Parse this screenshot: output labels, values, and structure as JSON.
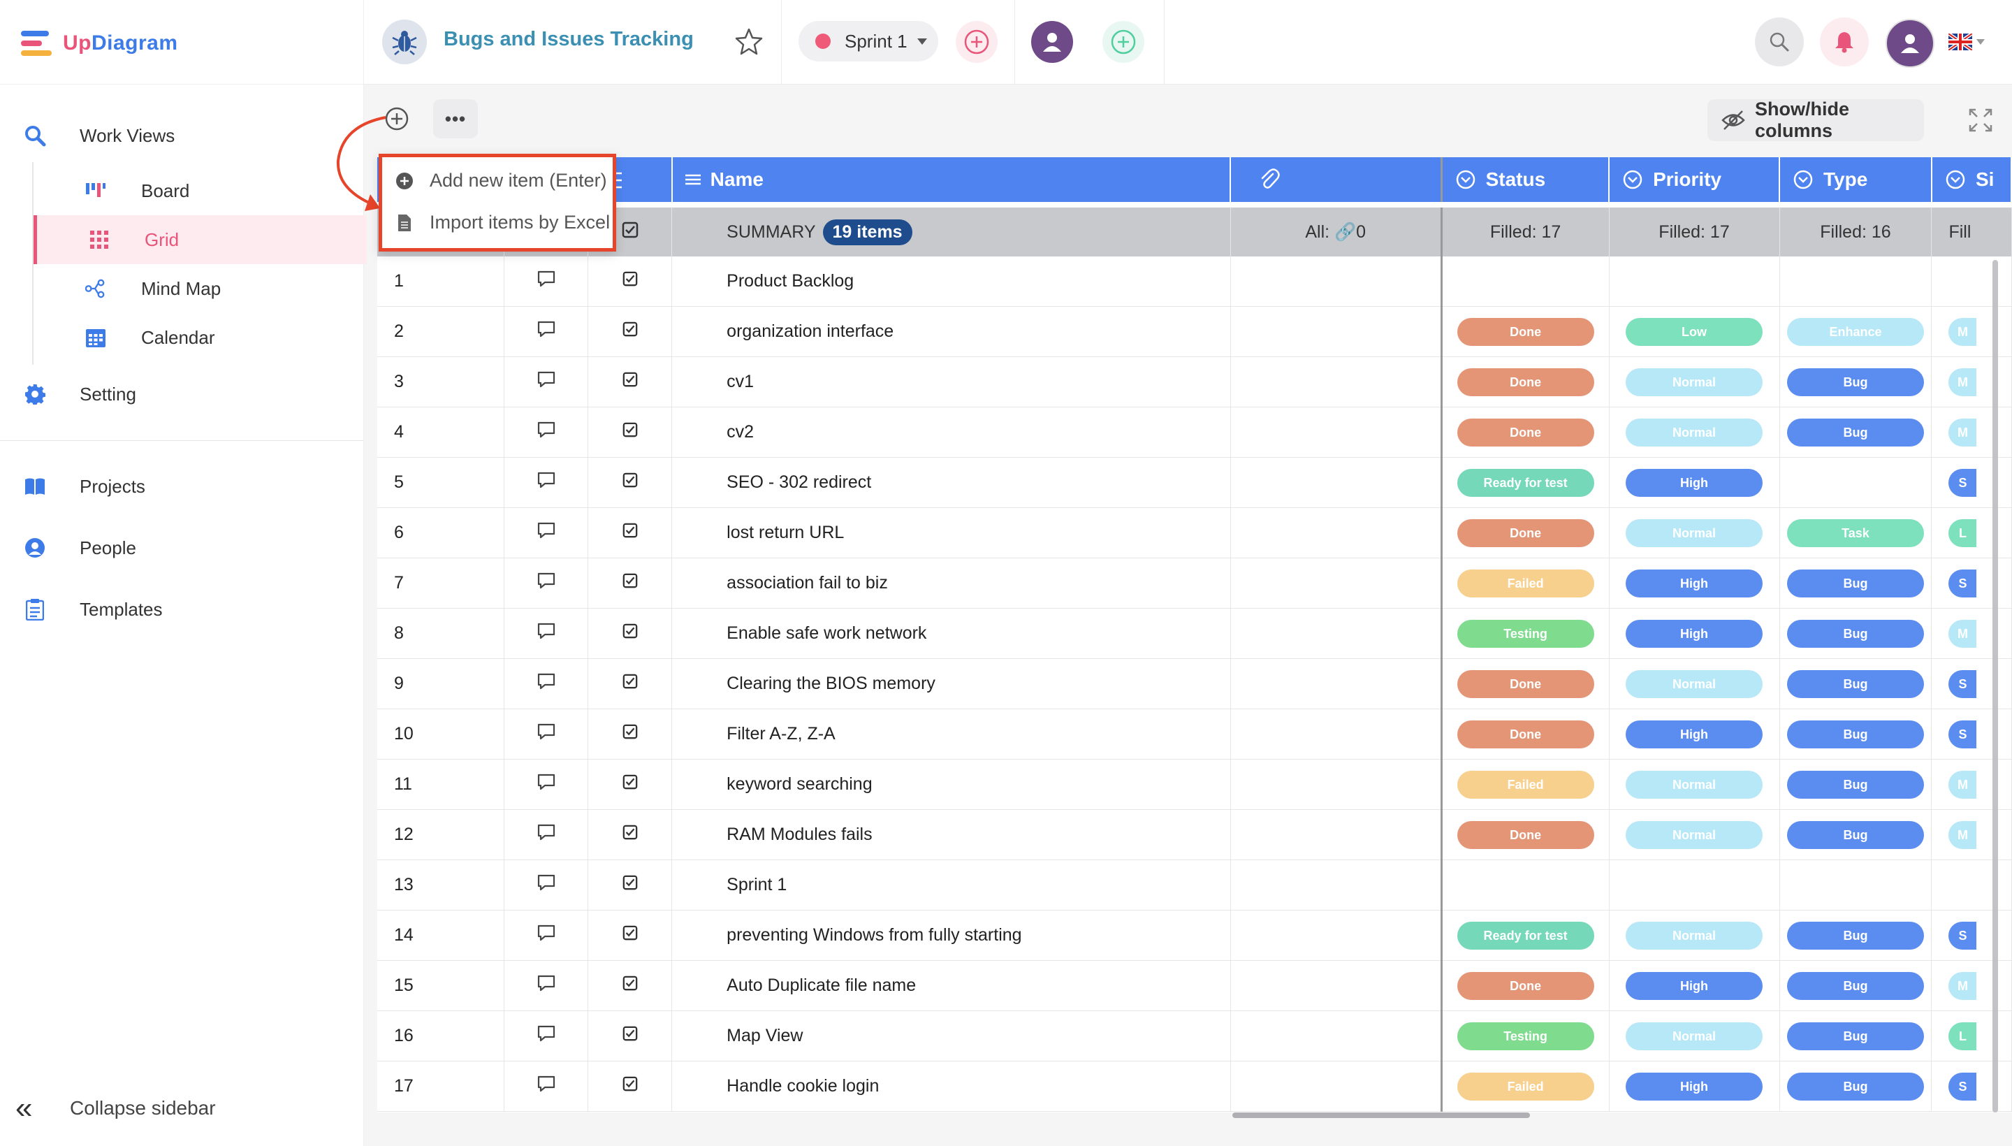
{
  "app": {
    "logo_prefix": "Up",
    "logo_suffix": "Diagram"
  },
  "sidebar": {
    "work_views": "Work Views",
    "views": [
      {
        "label": "Board",
        "icon": "board-icon",
        "active": false
      },
      {
        "label": "Grid",
        "icon": "grid-icon",
        "active": true
      },
      {
        "label": "Mind Map",
        "icon": "mind-map-icon",
        "active": false
      },
      {
        "label": "Calendar",
        "icon": "calendar-icon",
        "active": false
      }
    ],
    "setting": "Setting",
    "projects": "Projects",
    "people": "People",
    "templates": "Templates",
    "collapse": "Collapse sidebar"
  },
  "topbar": {
    "project_title": "Bugs and Issues Tracking",
    "sprint_label": "Sprint 1",
    "sprint_color": "#ef5a78",
    "brand_color": "#3d7ce8",
    "accent_color": "#e9547a"
  },
  "toolbar": {
    "more_label": "•••",
    "showhide_label": "Show/hide columns"
  },
  "menu": {
    "add_label": "Add new item (Enter)",
    "import_label": "Import items by Excel"
  },
  "grid": {
    "columns": {
      "name": "Name",
      "status": "Status",
      "priority": "Priority",
      "type": "Type",
      "extra": "Si"
    },
    "summary": {
      "label": "SUMMARY",
      "items_badge": "19 items",
      "attachments": "All: 🔗0",
      "status": "Filled: 17",
      "priority": "Filled: 17",
      "type": "Filled: 16",
      "extra": "Fill"
    },
    "rows": [
      {
        "num": "1",
        "name": "Product Backlog",
        "status": "",
        "priority": "",
        "type": "",
        "extra": ""
      },
      {
        "num": "2",
        "name": "organization interface",
        "status": "Done",
        "priority": "Low",
        "type": "Enhance",
        "extra": "M"
      },
      {
        "num": "3",
        "name": "cv1",
        "status": "Done",
        "priority": "Normal",
        "type": "Bug",
        "extra": "M"
      },
      {
        "num": "4",
        "name": "cv2",
        "status": "Done",
        "priority": "Normal",
        "type": "Bug",
        "extra": "M"
      },
      {
        "num": "5",
        "name": "SEO - 302 redirect",
        "status": "Ready for test",
        "priority": "High",
        "type": "",
        "extra": "S"
      },
      {
        "num": "6",
        "name": "lost return URL",
        "status": "Done",
        "priority": "Normal",
        "type": "Task",
        "extra": "L"
      },
      {
        "num": "7",
        "name": "association fail to biz",
        "status": "Failed",
        "priority": "High",
        "type": "Bug",
        "extra": "S"
      },
      {
        "num": "8",
        "name": "Enable safe work network",
        "status": "Testing",
        "priority": "High",
        "type": "Bug",
        "extra": "M"
      },
      {
        "num": "9",
        "name": "Clearing the BIOS memory",
        "status": "Done",
        "priority": "Normal",
        "type": "Bug",
        "extra": "S"
      },
      {
        "num": "10",
        "name": "Filter A-Z, Z-A",
        "status": "Done",
        "priority": "High",
        "type": "Bug",
        "extra": "S"
      },
      {
        "num": "11",
        "name": "keyword searching",
        "status": "Failed",
        "priority": "Normal",
        "type": "Bug",
        "extra": "M"
      },
      {
        "num": "12",
        "name": "RAM Modules fails",
        "status": "Done",
        "priority": "Normal",
        "type": "Bug",
        "extra": "M"
      },
      {
        "num": "13",
        "name": "Sprint 1",
        "status": "",
        "priority": "",
        "type": "",
        "extra": ""
      },
      {
        "num": "14",
        "name": "preventing Windows from fully starting",
        "status": "Ready for test",
        "priority": "Normal",
        "type": "Bug",
        "extra": "S"
      },
      {
        "num": "15",
        "name": "Auto Duplicate file name",
        "status": "Done",
        "priority": "High",
        "type": "Bug",
        "extra": "M"
      },
      {
        "num": "16",
        "name": "Map View",
        "status": "Testing",
        "priority": "Normal",
        "type": "Bug",
        "extra": "L"
      },
      {
        "num": "17",
        "name": "Handle cookie login",
        "status": "Failed",
        "priority": "High",
        "type": "Bug",
        "extra": "S"
      }
    ]
  }
}
